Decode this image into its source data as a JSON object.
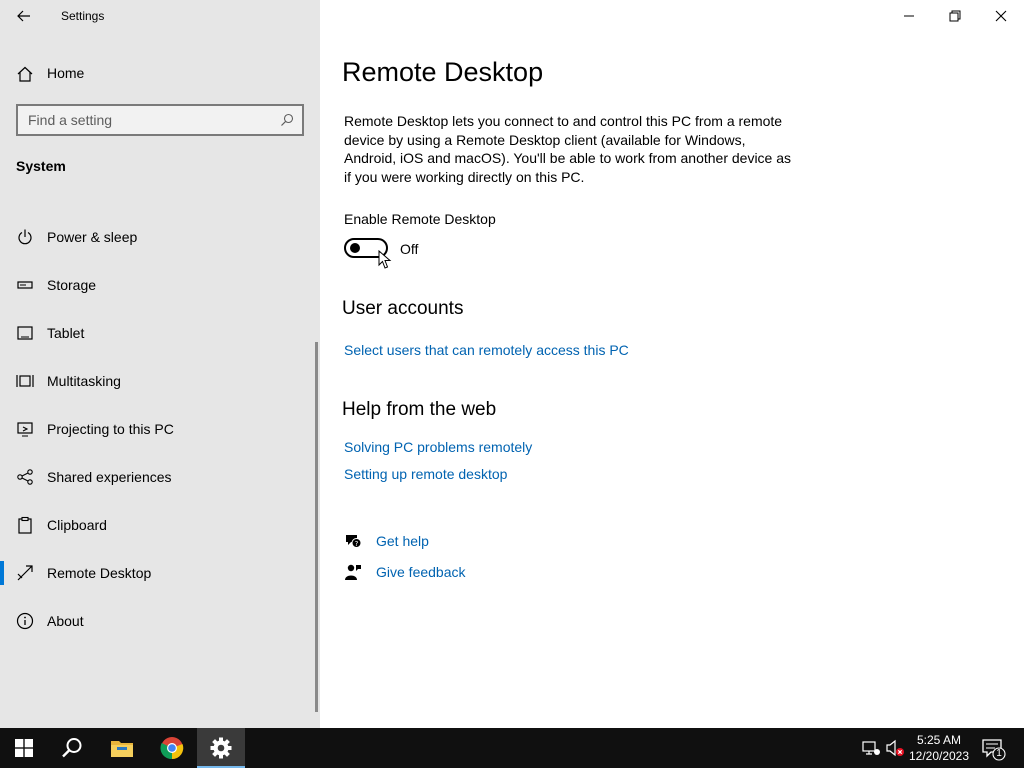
{
  "window": {
    "title": "Settings",
    "controls": [
      "minimize",
      "restore",
      "close"
    ]
  },
  "sidebar": {
    "home_label": "Home",
    "search_placeholder": "Find a setting",
    "section": "System",
    "items": [
      {
        "label": "Power & sleep",
        "icon": "power-icon"
      },
      {
        "label": "Storage",
        "icon": "storage-icon"
      },
      {
        "label": "Tablet",
        "icon": "tablet-icon"
      },
      {
        "label": "Multitasking",
        "icon": "multitasking-icon"
      },
      {
        "label": "Projecting to this PC",
        "icon": "projecting-icon"
      },
      {
        "label": "Shared experiences",
        "icon": "shared-experiences-icon"
      },
      {
        "label": "Clipboard",
        "icon": "clipboard-icon"
      },
      {
        "label": "Remote Desktop",
        "icon": "remote-desktop-icon",
        "selected": true
      },
      {
        "label": "About",
        "icon": "info-icon"
      }
    ]
  },
  "main": {
    "title": "Remote Desktop",
    "description": "Remote Desktop lets you connect to and control this PC from a remote device by using a Remote Desktop client (available for Windows, Android, iOS and macOS). You'll be able to work from another device as if you were working directly on this PC.",
    "toggle_label": "Enable Remote Desktop",
    "toggle_state": "Off",
    "toggle_on": false,
    "user_accounts_heading": "User accounts",
    "user_accounts_link": "Select users that can remotely access this PC",
    "help_heading": "Help from the web",
    "help_links": [
      "Solving PC problems remotely",
      "Setting up remote desktop"
    ],
    "get_help": "Get help",
    "give_feedback": "Give feedback"
  },
  "taskbar": {
    "apps": [
      "start-icon",
      "search-icon",
      "file-explorer-icon",
      "chrome-icon",
      "settings-icon"
    ],
    "active_app": "settings-icon",
    "time": "5:25 AM",
    "date": "12/20/2023",
    "notification_count": "1"
  },
  "colors": {
    "accent": "#0078d7",
    "link": "#0063b1",
    "sidebar_bg": "#e6e6e6",
    "taskbar_bg": "#101010"
  }
}
